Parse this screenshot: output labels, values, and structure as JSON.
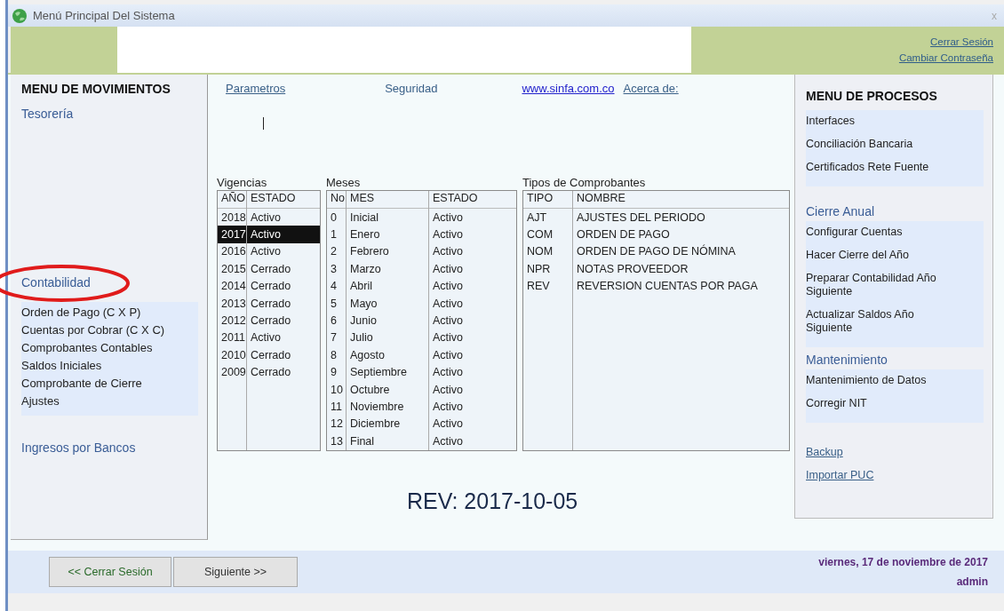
{
  "window": {
    "title": "Menú Principal Del Sistema",
    "close": "x"
  },
  "header": {
    "links": [
      "Cerrar Sesión",
      "Cambiar Contraseña"
    ]
  },
  "left_menu": {
    "title": "MENU DE MOVIMIENTOS",
    "sections": [
      {
        "label": "Tesorería",
        "circled": false
      },
      {
        "label": "Contabilidad",
        "circled": true,
        "items": [
          "Orden de Pago (C X P)",
          "Cuentas por Cobrar (C X C)",
          "Comprobantes Contables",
          "Saldos Iniciales",
          "Comprobante de Cierre",
          "Ajustes"
        ]
      },
      {
        "label": "Ingresos por Bancos",
        "circled": false
      }
    ]
  },
  "center": {
    "links": [
      {
        "label": "Parametros",
        "kind": "link"
      },
      {
        "label": "Seguridad",
        "kind": "plain"
      },
      {
        "label": "www.sinfa.com.co",
        "kind": "url"
      },
      {
        "label": "Acerca de:",
        "kind": "link"
      }
    ],
    "tables": [
      {
        "title": "Vigencias",
        "columns": [
          "AÑO",
          "ESTADO"
        ],
        "rows": [
          {
            "cells": [
              "2018",
              "Activo"
            ],
            "selected": false
          },
          {
            "cells": [
              "2017",
              "Activo"
            ],
            "selected": true
          },
          {
            "cells": [
              "2016",
              "Activo"
            ],
            "selected": false
          },
          {
            "cells": [
              "2015",
              "Cerrado"
            ],
            "selected": false
          },
          {
            "cells": [
              "2014",
              "Cerrado"
            ],
            "selected": false
          },
          {
            "cells": [
              "2013",
              "Cerrado"
            ],
            "selected": false
          },
          {
            "cells": [
              "2012",
              "Cerrado"
            ],
            "selected": false
          },
          {
            "cells": [
              "2011",
              "Activo"
            ],
            "selected": false
          },
          {
            "cells": [
              "2010",
              "Cerrado"
            ],
            "selected": false
          },
          {
            "cells": [
              "2009",
              "Cerrado"
            ],
            "selected": false
          }
        ]
      },
      {
        "title": "Meses",
        "columns": [
          "No",
          "MES",
          "ESTADO"
        ],
        "rows": [
          {
            "cells": [
              "0",
              "Inicial",
              "Activo"
            ],
            "selected": false
          },
          {
            "cells": [
              "1",
              "Enero",
              "Activo"
            ],
            "selected": false
          },
          {
            "cells": [
              "2",
              "Febrero",
              "Activo"
            ],
            "selected": false
          },
          {
            "cells": [
              "3",
              "Marzo",
              "Activo"
            ],
            "selected": false
          },
          {
            "cells": [
              "4",
              "Abril",
              "Activo"
            ],
            "selected": false
          },
          {
            "cells": [
              "5",
              "Mayo",
              "Activo"
            ],
            "selected": false
          },
          {
            "cells": [
              "6",
              "Junio",
              "Activo"
            ],
            "selected": false
          },
          {
            "cells": [
              "7",
              "Julio",
              "Activo"
            ],
            "selected": false
          },
          {
            "cells": [
              "8",
              "Agosto",
              "Activo"
            ],
            "selected": false
          },
          {
            "cells": [
              "9",
              "Septiembre",
              "Activo"
            ],
            "selected": false
          },
          {
            "cells": [
              "10",
              "Octubre",
              "Activo"
            ],
            "selected": false
          },
          {
            "cells": [
              "11",
              "Noviembre",
              "Activo"
            ],
            "selected": false
          },
          {
            "cells": [
              "12",
              "Diciembre",
              "Activo"
            ],
            "selected": false
          },
          {
            "cells": [
              "13",
              "Final",
              "Activo"
            ],
            "selected": false
          }
        ]
      },
      {
        "title": "Tipos de Comprobantes",
        "columns": [
          "TIPO",
          "NOMBRE"
        ],
        "rows": [
          {
            "cells": [
              "AJT",
              "AJUSTES DEL PERIODO"
            ],
            "selected": false
          },
          {
            "cells": [
              "COM",
              "ORDEN DE PAGO"
            ],
            "selected": false
          },
          {
            "cells": [
              "NOM",
              "ORDEN DE PAGO DE NÓMINA"
            ],
            "selected": false
          },
          {
            "cells": [
              "NPR",
              "NOTAS PROVEEDOR"
            ],
            "selected": false
          },
          {
            "cells": [
              "REV",
              "REVERSION CUENTAS POR PAGA"
            ],
            "selected": false
          }
        ]
      }
    ],
    "revision": "REV: 2017-10-05"
  },
  "right_menu": {
    "title": "MENU DE PROCESOS",
    "groups": [
      {
        "items": [
          "Interfaces",
          "Conciliación Bancaria",
          "Certificados Rete Fuente"
        ]
      },
      {
        "label": "Cierre Anual",
        "items": [
          "Configurar  Cuentas",
          "Hacer Cierre del Año",
          "Preparar Contabilidad Año Siguiente",
          "Actualizar Saldos Año Siguiente"
        ]
      },
      {
        "label": "Mantenimiento",
        "items": [
          "Mantenimiento de Datos",
          "Corregir NIT"
        ]
      }
    ],
    "links": [
      "Backup",
      "Importar PUC"
    ]
  },
  "footer": {
    "buttons": [
      "<< Cerrar Sesión",
      "Siguiente >>"
    ],
    "date": "viernes, 17 de noviembre de 2017",
    "user": "admin"
  }
}
